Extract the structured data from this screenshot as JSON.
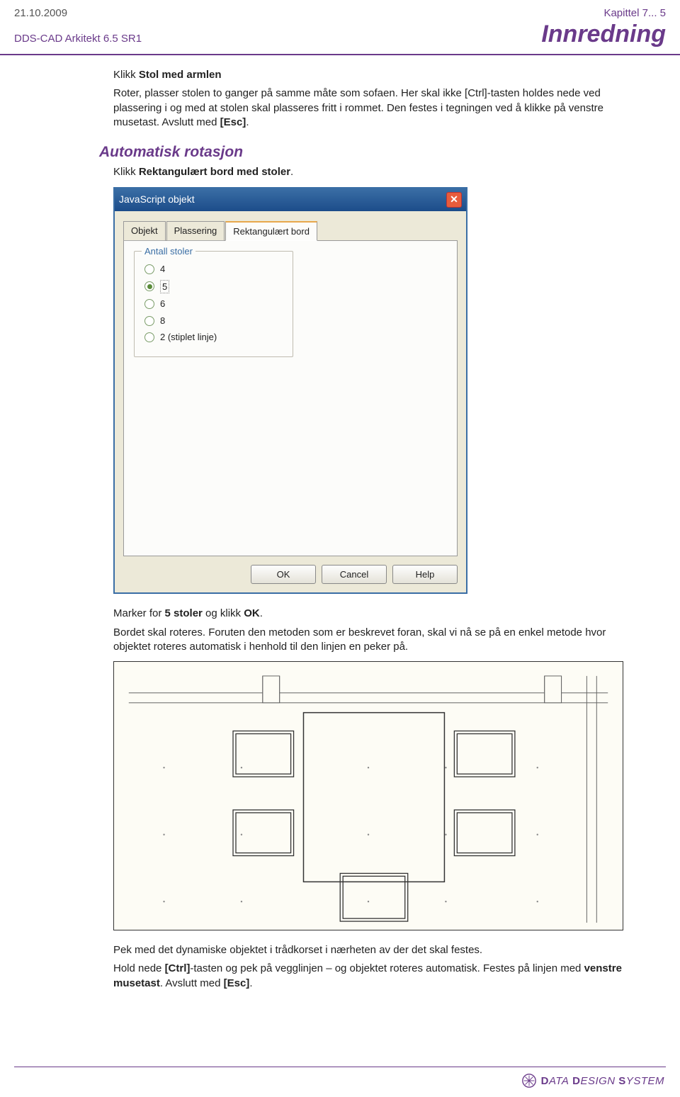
{
  "header": {
    "date": "21.10.2009",
    "chapter": "Kapittel 7... 5",
    "product": "DDS-CAD Arkitekt  6.5 SR1",
    "title": "Innredning"
  },
  "content": {
    "p1_prefix": "Klikk ",
    "p1_bold": "Stol med armlen",
    "p2": "Roter, plasser stolen to ganger på samme måte som sofaen. Her skal ikke [Ctrl]-tasten holdes nede ved plassering i og med at stolen skal plasseres fritt i rommet. Den festes i tegningen ved å klikke på venstre musetast. Avslutt med ",
    "p2_bold": "[Esc]",
    "p2_after": ".",
    "section": "Automatisk rotasjon",
    "p3_prefix": "Klikk ",
    "p3_bold": "Rektangulært bord med stoler",
    "p3_after": ".",
    "p4_pre": "Marker for ",
    "p4_bold1": "5 stoler",
    "p4_mid": " og klikk ",
    "p4_bold2": "OK",
    "p4_after": ".",
    "p5": "Bordet skal roteres. Foruten den metoden som er beskrevet foran, skal vi nå se på en enkel metode hvor objektet roteres automatisk i henhold til den linjen en peker på.",
    "p6": "Pek med det dynamiske objektet i trådkorset i nærheten av der det skal festes.",
    "p7_pre": "Hold nede ",
    "p7_b1": "[Ctrl]",
    "p7_mid1": "-tasten og pek på vegglinjen – og objektet roteres automatisk. Festes på linjen med ",
    "p7_b2": "venstre musetast",
    "p7_mid2": ". Avslutt med ",
    "p7_b3": "[Esc]",
    "p7_after": "."
  },
  "dialog": {
    "title": "JavaScript objekt",
    "tabs": [
      "Objekt",
      "Plassering",
      "Rektangulært bord"
    ],
    "group": "Antall stoler",
    "options": [
      "4",
      "5",
      "6",
      "8",
      "2 (stiplet linje)"
    ],
    "selected": 1,
    "buttons": [
      "OK",
      "Cancel",
      "Help"
    ]
  },
  "footer": {
    "company": "DATA DESIGN SYSTEM"
  }
}
